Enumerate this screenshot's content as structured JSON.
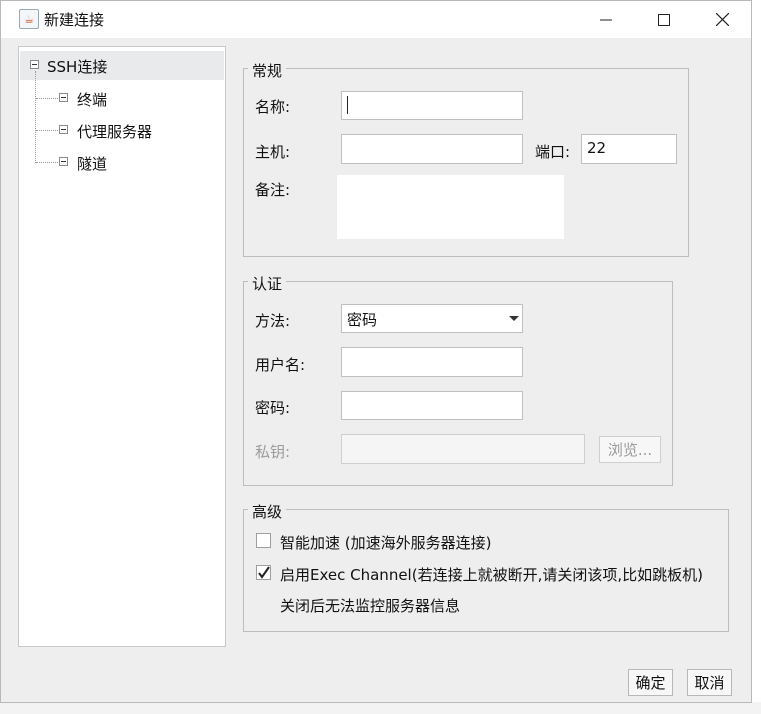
{
  "window": {
    "title": "新建连接",
    "icon": "java-cup-icon"
  },
  "tree": {
    "root": "SSH连接",
    "children": [
      "终端",
      "代理服务器",
      "隧道"
    ]
  },
  "general": {
    "title": "常规",
    "name_label": "名称:",
    "name_value": "",
    "host_label": "主机:",
    "host_value": "",
    "port_label": "端口:",
    "port_value": "22",
    "note_label": "备注:",
    "note_value": ""
  },
  "auth": {
    "title": "认证",
    "method_label": "方法:",
    "method_value": "密码",
    "user_label": "用户名:",
    "user_value": "",
    "password_label": "密码:",
    "password_value": "",
    "key_label": "私钥:",
    "key_value": "",
    "browse_label": "浏览..."
  },
  "advanced": {
    "title": "高级",
    "smart_accel_label": "智能加速 (加速海外服务器连接)",
    "smart_accel_checked": false,
    "exec_channel_label": "启用Exec Channel(若连接上就被断开,请关闭该项,比如跳板机)",
    "exec_channel_checked": true,
    "exec_channel_note": "关闭后无法监控服务器信息"
  },
  "buttons": {
    "ok": "确定",
    "cancel": "取消"
  }
}
